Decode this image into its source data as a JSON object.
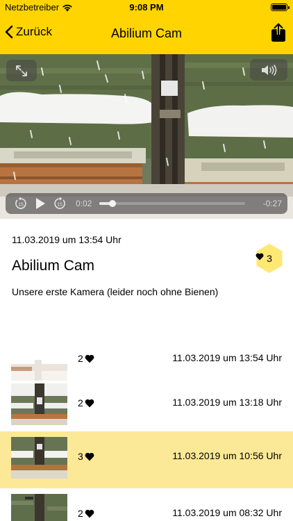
{
  "status_bar": {
    "carrier": "Netzbetreiber",
    "time": "9:08 PM"
  },
  "nav": {
    "back_label": "Zurück",
    "title": "Abilium Cam"
  },
  "player": {
    "elapsed": "0:02",
    "remaining": "-0:27",
    "progress": 0.09,
    "skip_seconds": "15"
  },
  "info": {
    "date": "11.03.2019 um 13:54 Uhr",
    "title": "Abilium Cam",
    "description": "Unsere erste Kamera (leider noch ohne Bienen)",
    "likes": "3"
  },
  "recordings": [
    {
      "likes": "2",
      "date": "11.03.2019 um 13:54 Uhr",
      "selected": false
    },
    {
      "likes": "2",
      "date": "11.03.2019 um 13:18 Uhr",
      "selected": false
    },
    {
      "likes": "3",
      "date": "11.03.2019 um 10:56 Uhr",
      "selected": true
    },
    {
      "likes": "2",
      "date": "11.03.2019 um 08:32 Uhr",
      "selected": false
    }
  ],
  "colors": {
    "accent": "#FFD400",
    "selected_row": "#FCE997",
    "hexagon": "#FFE873"
  }
}
